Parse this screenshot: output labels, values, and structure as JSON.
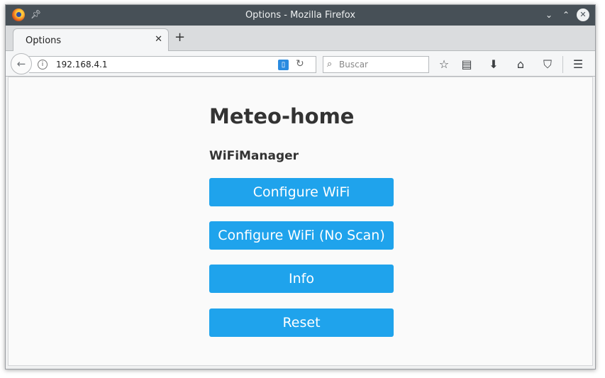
{
  "window": {
    "title": "Options - Mozilla Firefox"
  },
  "tabs": [
    {
      "label": "Options",
      "close": "✕"
    }
  ],
  "tabstrip": {
    "new_tab": "+"
  },
  "navbar": {
    "url": "192.168.4.1",
    "search_placeholder": "Buscar"
  },
  "icons": {
    "firefox": "firefox-logo-icon",
    "pin": "pin-icon",
    "minimize": "chevron-down-icon",
    "maximize": "chevron-up-icon",
    "close": "close-icon",
    "back": "back-arrow-icon",
    "info": "info-icon",
    "reader": "reader-view-icon",
    "reload": "reload-icon",
    "search": "search-icon",
    "bookmark": "star-icon",
    "bookmarks_menu": "clipboard-icon",
    "downloads": "download-arrow-icon",
    "home": "home-icon",
    "pocket": "pocket-icon",
    "menu": "hamburger-menu-icon"
  },
  "page": {
    "heading": "Meteo-home",
    "subheading": "WiFiManager",
    "buttons": [
      {
        "label": "Configure WiFi"
      },
      {
        "label": "Configure WiFi (No Scan)"
      },
      {
        "label": "Info"
      },
      {
        "label": "Reset"
      }
    ]
  },
  "colors": {
    "button_bg": "#1fa3ec",
    "titlebar_bg": "#475057"
  }
}
